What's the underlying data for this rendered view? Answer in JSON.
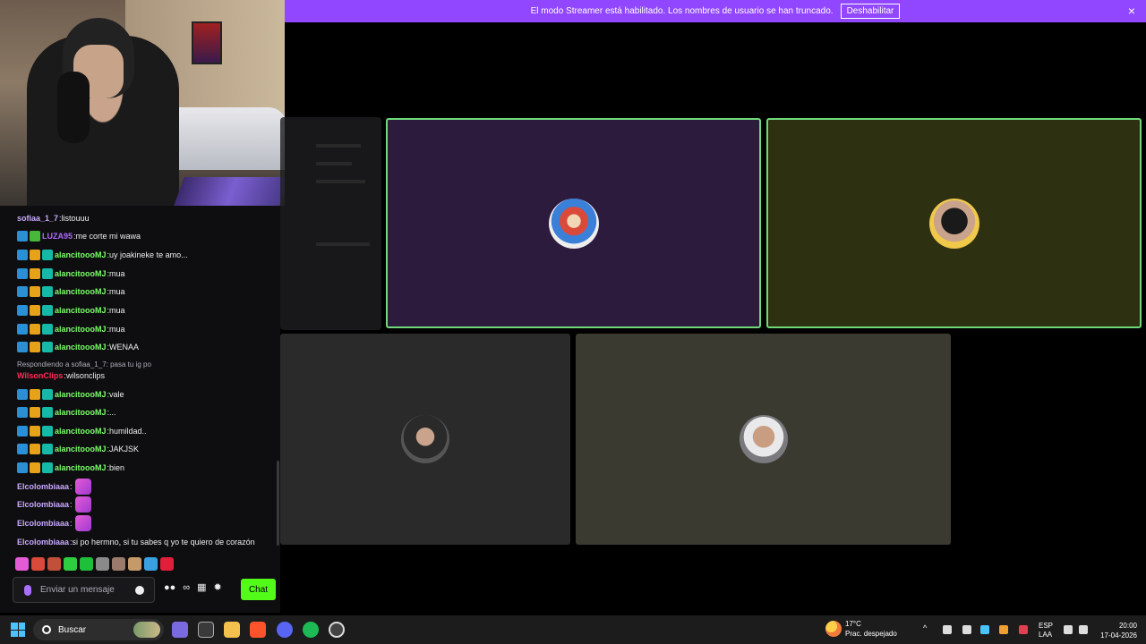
{
  "banner": {
    "message": "El modo Streamer está habilitado. Los nombres de usuario se han truncado.",
    "button": "Deshabilitar",
    "close": "×"
  },
  "chat": {
    "messages": [
      {
        "user": "sofiaa_1_7",
        "text": "listouuu",
        "color": "#c8a8ff",
        "badges": []
      },
      {
        "user": "LUZA95",
        "text": "me corte mi wawa",
        "color": "#b06cff",
        "badges": [
          "blue",
          "green"
        ]
      },
      {
        "user": "alancitoooMJ",
        "text": "uy joakineke te amo...",
        "color": "#7cff6a",
        "badges": [
          "blue",
          "gold",
          "teal"
        ]
      },
      {
        "user": "alancitoooMJ",
        "text": "mua",
        "color": "#7cff6a",
        "badges": [
          "blue",
          "gold",
          "teal"
        ]
      },
      {
        "user": "alancitoooMJ",
        "text": "mua",
        "color": "#7cff6a",
        "badges": [
          "blue",
          "gold",
          "teal"
        ]
      },
      {
        "user": "alancitoooMJ",
        "text": "mua",
        "color": "#7cff6a",
        "badges": [
          "blue",
          "gold",
          "teal"
        ]
      },
      {
        "user": "alancitoooMJ",
        "text": "mua",
        "color": "#7cff6a",
        "badges": [
          "blue",
          "gold",
          "teal"
        ]
      },
      {
        "user": "alancitoooMJ",
        "text": "WENAA",
        "color": "#7cff6a",
        "badges": [
          "blue",
          "gold",
          "teal"
        ]
      },
      {
        "user": "WilsonClips",
        "text": "wilsonclips",
        "color": "#ff2a55",
        "badges": []
      },
      {
        "user": "alancitoooMJ",
        "text": "vale",
        "color": "#7cff6a",
        "badges": [
          "blue",
          "gold",
          "teal"
        ]
      },
      {
        "user": "alancitoooMJ",
        "text": "...",
        "color": "#7cff6a",
        "badges": [
          "blue",
          "gold",
          "teal"
        ]
      },
      {
        "user": "alancitoooMJ",
        "text": "humildad..",
        "color": "#7cff6a",
        "badges": [
          "blue",
          "gold",
          "teal"
        ]
      },
      {
        "user": "alancitoooMJ",
        "text": "JAKJSK",
        "color": "#7cff6a",
        "badges": [
          "blue",
          "gold",
          "teal"
        ]
      },
      {
        "user": "alancitoooMJ",
        "text": "bien",
        "color": "#7cff6a",
        "badges": [
          "blue",
          "gold",
          "teal"
        ]
      },
      {
        "user": "Elcolombiaaa",
        "text": "",
        "color": "#c8a8ff",
        "badges": [],
        "emote": true
      },
      {
        "user": "Elcolombiaaa",
        "text": "",
        "color": "#c8a8ff",
        "badges": [],
        "emote": true
      },
      {
        "user": "Elcolombiaaa",
        "text": "",
        "color": "#c8a8ff",
        "badges": [],
        "emote": true
      },
      {
        "user": "Elcolombiaaa",
        "text": "si po hermno, si tu sabes q yo te quiero de corazón",
        "color": "#c8a8ff",
        "badges": []
      }
    ],
    "reply_note": "Respondiendo a sofiaa_1_7: pasa tu ig po",
    "input_placeholder": "Enviar un mensaje",
    "send_label": "Chat",
    "infinity": "∞"
  },
  "taskbar": {
    "search_label": "Buscar",
    "weather_temp": "17°C",
    "weather_desc": "Prac. despejado",
    "lang_top": "ESP",
    "lang_bottom": "LAA",
    "time": "20:00",
    "date": "17-04-2026"
  },
  "colors": {
    "streamer_banner": "#9147ff",
    "send_button": "#53fc18",
    "speaking_border": "#6fd97a",
    "tile_purple": "#2d1b3d",
    "tile_olive": "#2e3012",
    "tile_gray": "#2a2a2a",
    "tile_khaki": "#3a3a30"
  }
}
